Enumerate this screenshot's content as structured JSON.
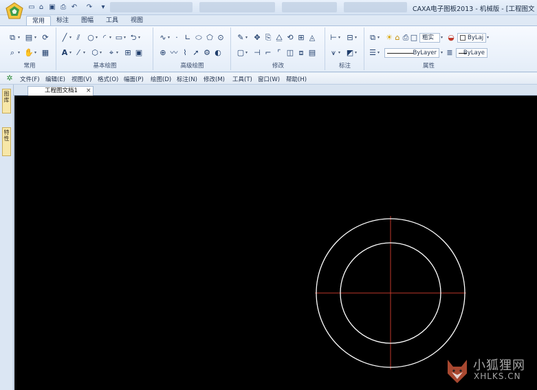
{
  "window": {
    "title": "CAXA电子图板2013 - 机械版 - [工程图文"
  },
  "quick_access": {
    "icons": [
      "new-file-icon",
      "open-folder-icon",
      "save-icon",
      "print-icon",
      "undo-icon",
      "redo-icon",
      "customize-icon"
    ]
  },
  "ribbon": {
    "tabs": [
      {
        "label": "常用",
        "active": true
      },
      {
        "label": "标注",
        "active": false
      },
      {
        "label": "图幅",
        "active": false
      },
      {
        "label": "工具",
        "active": false
      },
      {
        "label": "视图",
        "active": false
      }
    ],
    "groups": {
      "common": "常用",
      "basic_draw": "基本绘图",
      "advanced_draw": "高级绘图",
      "modify": "修改",
      "annotate": "标注",
      "properties": "属性"
    },
    "properties": {
      "layer_name": "粗实",
      "color_value": "ByLaj",
      "linetype_value": "ByLayer",
      "linewidth_value": "ByLaye"
    }
  },
  "menubar": {
    "items": [
      "文件(F)",
      "编辑(E)",
      "视图(V)",
      "格式(O)",
      "幅面(P)",
      "绘图(D)",
      "标注(N)",
      "修改(M)",
      "工具(T)",
      "窗口(W)",
      "帮助(H)"
    ]
  },
  "sidepanel": {
    "tabs": [
      "图库",
      "特性"
    ]
  },
  "document": {
    "tab_label": "工程图文档1",
    "close_glyph": "×"
  },
  "canvas": {
    "background": "#000000",
    "circle_color": "#ffffff",
    "centerline_color": "#c0392b"
  },
  "watermark": {
    "title": "小狐狸网",
    "subtitle": "XHLKS.CN"
  }
}
